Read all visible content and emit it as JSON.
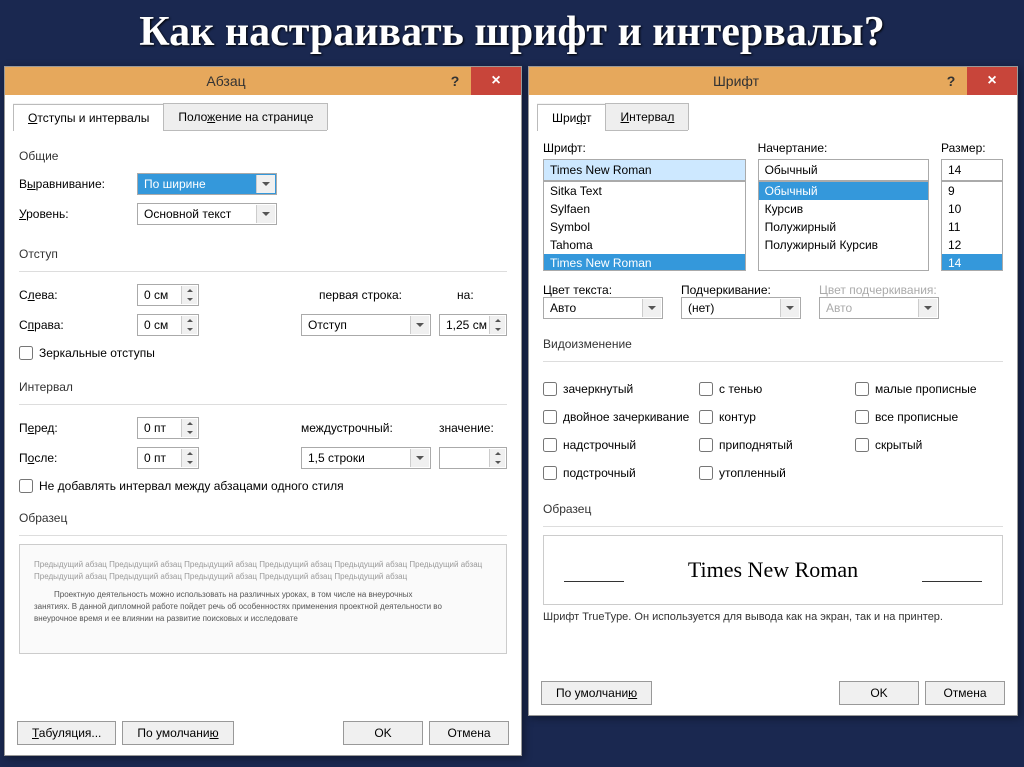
{
  "page_title": "Как настраивать шрифт и интервалы?",
  "paragraph_dialog": {
    "title": "Абзац",
    "help": "?",
    "close": "×",
    "tabs": {
      "t1": "Отступы и интервалы",
      "t2": "Положение на странице"
    },
    "general": {
      "label": "Общие",
      "align_label": "Выравнивание:",
      "align_value": "По ширине",
      "level_label": "Уровень:",
      "level_value": "Основной текст"
    },
    "indent": {
      "label": "Отступ",
      "left_label": "Слева:",
      "left_value": "0 см",
      "right_label": "Справа:",
      "right_value": "0 см",
      "firstline_label": "первая строка:",
      "firstline_value": "Отступ",
      "by_label": "на:",
      "by_value": "1,25 см",
      "mirror": "Зеркальные отступы"
    },
    "spacing": {
      "label": "Интервал",
      "before_label": "Перед:",
      "before_value": "0 пт",
      "after_label": "После:",
      "after_value": "0 пт",
      "line_label": "междустрочный:",
      "line_value": "1,5 строки",
      "at_label": "значение:",
      "nogap": "Не добавлять интервал между абзацами одного стиля"
    },
    "preview": {
      "label": "Образец",
      "text1": "Предыдущий абзац Предыдущий абзац Предыдущий абзац Предыдущий абзац Предыдущий абзац Предыдущий абзац Предыдущий абзац Предыдущий абзац Предыдущий абзац Предыдущий абзац Предыдущий абзац",
      "text2": "Проектную деятельность можно использовать на различных уроках, в том числе на внеурочных",
      "text3": "занятиях. В данной дипломной работе пойдет речь об особенностях применения проектной деятельности во",
      "text4": "внеурочное время и ее влиянии на развитие поисковых и исследовате"
    },
    "buttons": {
      "tabs": "Табуляция...",
      "default": "По умолчанию",
      "ok": "OK",
      "cancel": "Отмена"
    }
  },
  "font_dialog": {
    "title": "Шрифт",
    "help": "?",
    "close": "×",
    "tabs": {
      "t1": "Шрифт",
      "t2": "Интервал"
    },
    "font": {
      "label": "Шрифт:",
      "value": "Times New Roman",
      "list": [
        "Sitka Text",
        "Sylfaen",
        "Symbol",
        "Tahoma",
        "Times New Roman"
      ]
    },
    "style": {
      "label": "Начертание:",
      "value": "Обычный",
      "list": [
        "Обычный",
        "Курсив",
        "Полужирный",
        "Полужирный Курсив"
      ]
    },
    "size": {
      "label": "Размер:",
      "value": "14",
      "list": [
        "9",
        "10",
        "11",
        "12",
        "14"
      ]
    },
    "textcolor": {
      "label": "Цвет текста:",
      "value": "Авто"
    },
    "underline": {
      "label": "Подчеркивание:",
      "value": "(нет)"
    },
    "ulcolor": {
      "label": "Цвет подчеркивания:",
      "value": "Авто"
    },
    "effects": {
      "label": "Видоизменение",
      "items": {
        "e1": "зачеркнутый",
        "e2": "с тенью",
        "e3": "малые прописные",
        "e4": "двойное зачеркивание",
        "e5": "контур",
        "e6": "все прописные",
        "e7": "надстрочный",
        "e8": "приподнятый",
        "e9": "скрытый",
        "e10": "подстрочный",
        "e11": "утопленный"
      }
    },
    "sample": {
      "label": "Образец",
      "text": "Times New Roman"
    },
    "footer": "Шрифт TrueType. Он используется для вывода как на экран, так и на принтер.",
    "buttons": {
      "default": "По умолчанию",
      "ok": "OK",
      "cancel": "Отмена"
    }
  }
}
